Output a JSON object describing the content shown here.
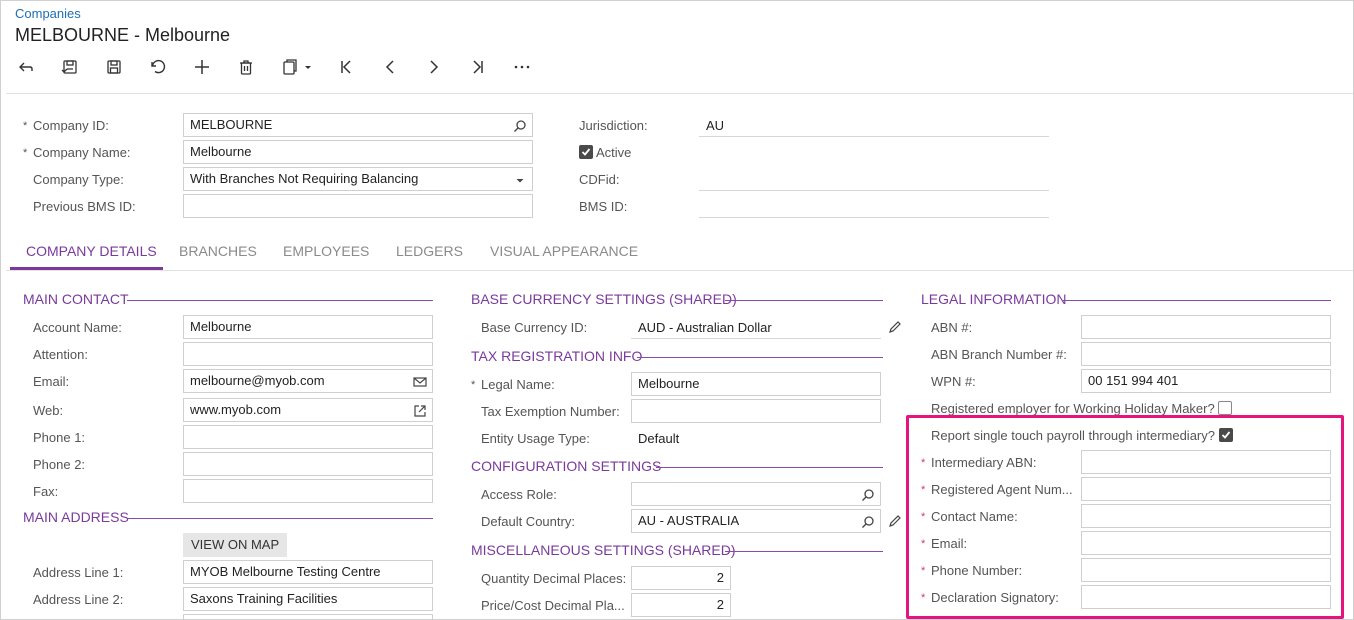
{
  "breadcrumb": "Companies",
  "title": "MELBOURNE - Melbourne",
  "toolbar": {
    "icons": [
      "back-icon",
      "save-close-icon",
      "save-icon",
      "undo-icon",
      "add-icon",
      "delete-icon",
      "copy-paste-icon",
      "first-icon",
      "previous-icon",
      "next-icon",
      "last-icon",
      "more-icon"
    ]
  },
  "header": {
    "company_id_label": "Company ID:",
    "company_id": "MELBOURNE",
    "company_name_label": "Company Name:",
    "company_name": "Melbourne",
    "company_type_label": "Company Type:",
    "company_type": "With Branches Not Requiring Balancing",
    "prev_bms_label": "Previous BMS ID:",
    "prev_bms": "",
    "jurisdiction_label": "Jurisdiction:",
    "jurisdiction": "AU",
    "active_label": "Active",
    "active": true,
    "cdfid_label": "CDFid:",
    "bms_label": "BMS ID:"
  },
  "tabs": [
    "COMPANY DETAILS",
    "BRANCHES",
    "EMPLOYEES",
    "LEDGERS",
    "VISUAL APPEARANCE"
  ],
  "main_contact": {
    "title": "MAIN CONTACT",
    "account_name_label": "Account Name:",
    "account_name": "Melbourne",
    "attention_label": "Attention:",
    "attention": "",
    "email_label": "Email:",
    "email": "melbourne@myob.com",
    "web_label": "Web:",
    "web": "www.myob.com",
    "phone1_label": "Phone 1:",
    "phone2_label": "Phone 2:",
    "fax_label": "Fax:"
  },
  "main_address": {
    "title": "MAIN ADDRESS",
    "view_on_map": "VIEW ON MAP",
    "line1_label": "Address Line 1:",
    "line1": "MYOB Melbourne Testing Centre",
    "line2_label": "Address Line 2:",
    "line2": "Saxons Training Facilities"
  },
  "base_currency": {
    "title": "BASE CURRENCY SETTINGS (SHARED)",
    "currency_label": "Base Currency ID:",
    "currency": "AUD - Australian Dollar"
  },
  "tax_registration": {
    "title": "TAX REGISTRATION INFO",
    "legal_name_label": "Legal Name:",
    "legal_name": "Melbourne",
    "tax_exemption_label": "Tax Exemption Number:",
    "tax_exemption": "",
    "entity_usage_label": "Entity Usage Type:",
    "entity_usage": "Default"
  },
  "configuration": {
    "title": "CONFIGURATION SETTINGS",
    "access_role_label": "Access Role:",
    "access_role": "",
    "default_country_label": "Default Country:",
    "default_country": "AU - AUSTRALIA"
  },
  "misc": {
    "title": "MISCELLANEOUS SETTINGS (SHARED)",
    "qty_label": "Quantity Decimal Places:",
    "qty": "2",
    "price_label": "Price/Cost Decimal Pla...",
    "price": "2"
  },
  "legal": {
    "title": "LEGAL INFORMATION",
    "abn_label": "ABN #:",
    "abn": "",
    "abn_branch_label": "ABN Branch Number #:",
    "abn_branch": "",
    "wpn_label": "WPN #:",
    "wpn": "00 151 994 401",
    "whm_label": "Registered employer for Working Holiday Maker?",
    "whm": false,
    "stp_label": "Report single touch payroll through intermediary?",
    "stp": true,
    "intermediary_abn_label": "Intermediary ABN:",
    "agent_num_label": "Registered Agent Num...",
    "contact_name_label": "Contact Name:",
    "email_label": "Email:",
    "phone_label": "Phone Number:",
    "signatory_label": "Declaration Signatory:"
  },
  "colors": {
    "accent": "#7a3a9b",
    "link": "#1f6fb3",
    "highlight": "#e6157e",
    "required": "#d53b5c"
  }
}
